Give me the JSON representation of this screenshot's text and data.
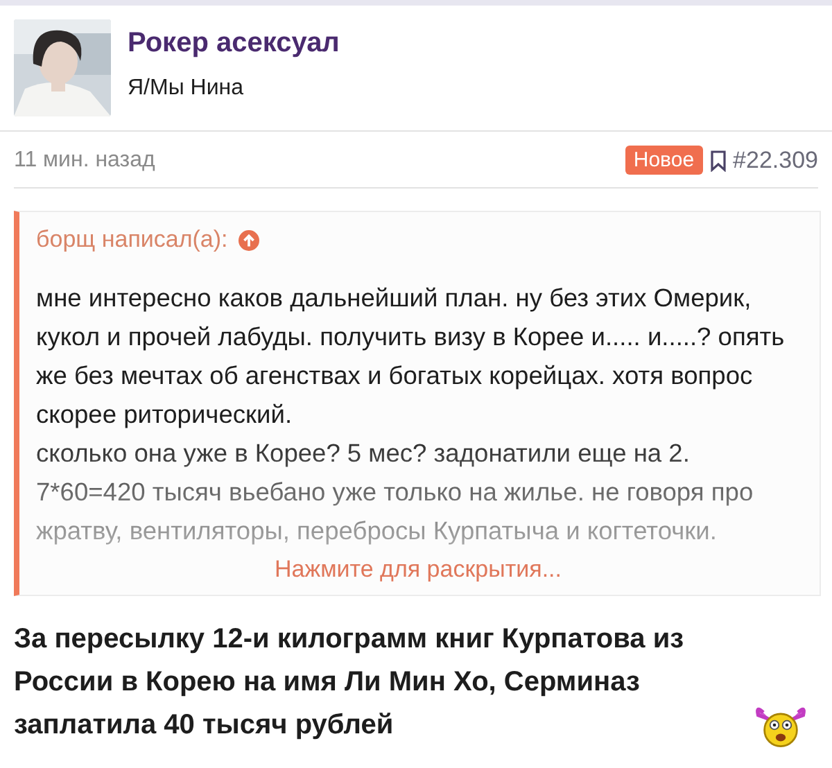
{
  "author": {
    "name": "Рокер асексуал",
    "subtitle": "Я/Мы Нина"
  },
  "meta": {
    "time": "11 мин. назад",
    "badge": "Новое",
    "post_number": "#22.309"
  },
  "quote": {
    "header": "борщ написал(а):",
    "paragraphs": [
      "мне интересно каков дальнейший план. ну без этих Омерик, кукол и прочей лабуды. получить визу в Корее и..... и.....? опять же без мечтах об агенствах и богатых корейцах. хотя вопрос скорее риторический.",
      "сколько она уже в Корее? 5 мес? задонатили еще на 2. 7*60=420 тысяч вьебано уже только на жилье. не говоря про жратву, вентиляторы, перебросы Курпатыча и когтеточки."
    ],
    "expand_link": "Нажмите для раскрытия..."
  },
  "message": "За пересылку 12-и килограмм книг Курпатова из России в Корею на имя Ли Мин Хо, Серминаз заплатила 40 тысяч рублей"
}
